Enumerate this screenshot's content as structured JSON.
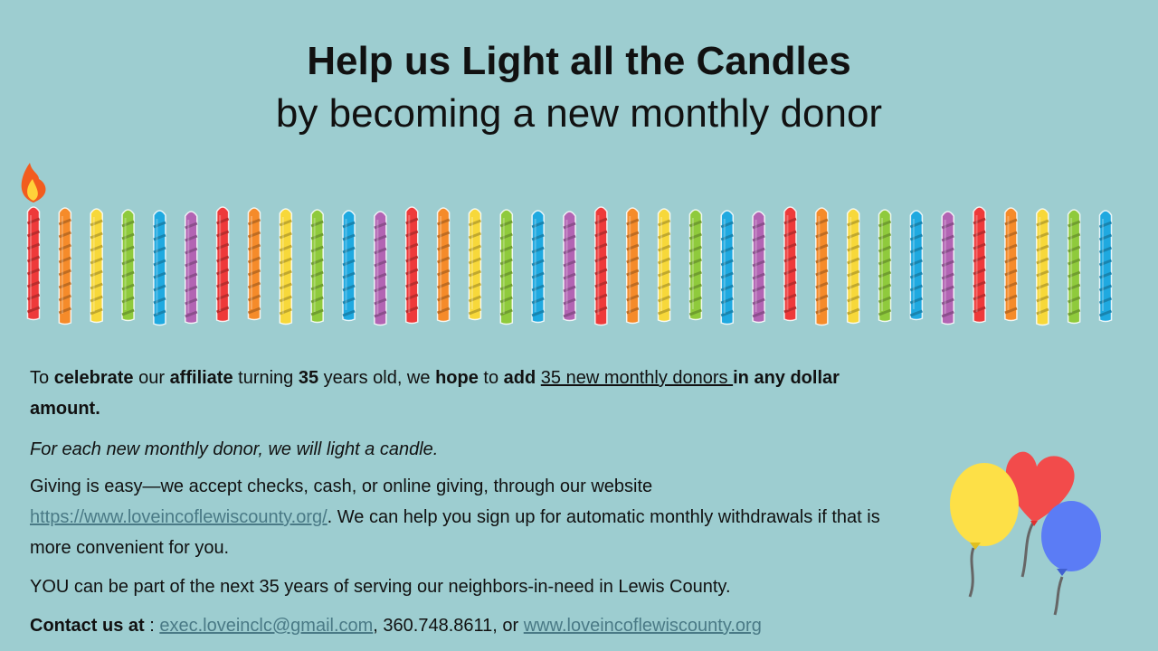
{
  "heading": {
    "title": "Help us Light all the Candles",
    "subtitle": "by becoming a new monthly donor"
  },
  "candles": {
    "total": 35,
    "lit": 1,
    "palette": [
      "#ee3a3a",
      "#f58b2a",
      "#f7d83a",
      "#8fca3c",
      "#1fa9e0",
      "#b264b3"
    ],
    "flame_icon": "fire-emoji"
  },
  "body": {
    "p1": {
      "t1": "To ",
      "b1": "celebrate",
      "t2": " our ",
      "b2": "affiliate",
      "t3": " turning ",
      "b3": "35",
      "t4": " years old, we ",
      "b4": "hope",
      "t5": " to ",
      "b5": "add",
      "u1": "35 new monthly donors ",
      "b6": "in any dollar amount."
    },
    "p2": "For each new monthly donor, we will light a candle.",
    "p3": {
      "t1": "Giving is easy—we accept checks, cash, or online giving, through our website ",
      "link": "https://www.loveincoflewiscounty.org/",
      "t2": ". We can help you sign up for automatic monthly withdrawals if that is more convenient for you."
    },
    "p4": "YOU can be part of the next 35 years of serving our neighbors-in-need in Lewis County.",
    "p5": {
      "label": "Contact us at",
      "colon": " : ",
      "email": "exec.loveinclc@gmail.com",
      "sep1": ", 360.748.8611, or ",
      "site": "www.loveincoflewiscounty.org"
    }
  },
  "balloons": {
    "colors": [
      "#fde047",
      "#f24b4b",
      "#5b7cf5"
    ],
    "string_color": "#666666"
  }
}
